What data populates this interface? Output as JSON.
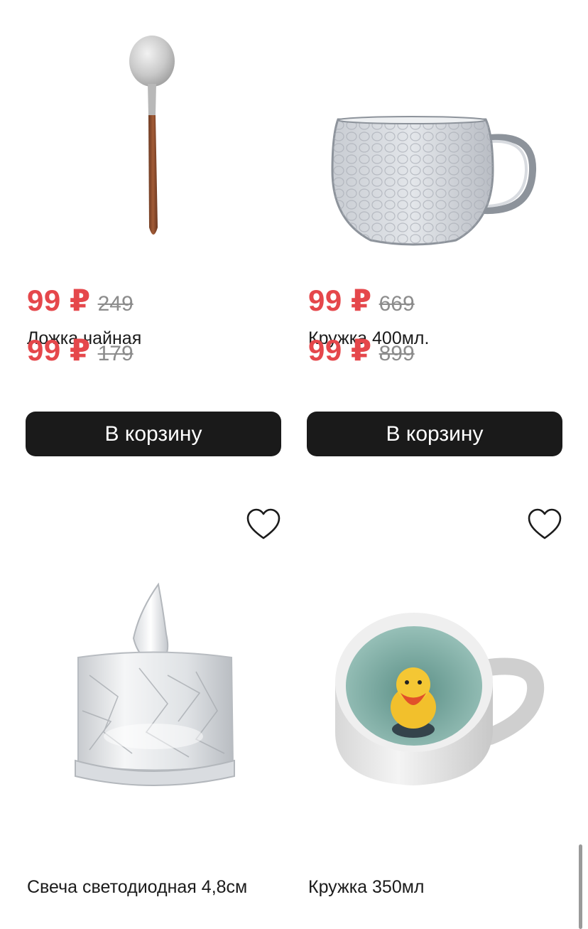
{
  "products": [
    {
      "price": "99 ₽",
      "old_price": "249",
      "name": "Ложка чайная",
      "button": "В корзину",
      "image": "teaspoon"
    },
    {
      "price": "99 ₽",
      "old_price": "669",
      "name": "Кружка 400мл.",
      "button": "В корзину",
      "image": "glass-mug"
    },
    {
      "price": "99 ₽",
      "old_price": "179",
      "name": "Свеча светодиодная 4,8см",
      "image": "led-candle",
      "favorite_icon": "heart-outline-icon"
    },
    {
      "price": "99 ₽",
      "old_price": "899",
      "name": "Кружка 350мл",
      "image": "duck-mug",
      "favorite_icon": "heart-outline-icon"
    }
  ],
  "colors": {
    "price": "#e5474b",
    "old_price": "#8c8c8c",
    "button_bg": "#1a1a1a",
    "button_text": "#ffffff"
  }
}
